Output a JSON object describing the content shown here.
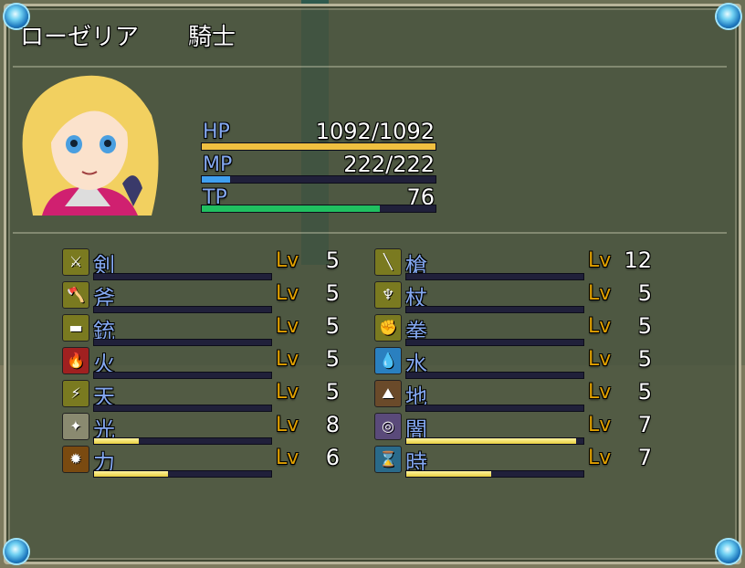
{
  "actor": {
    "name": "ローゼリア",
    "class": "騎士"
  },
  "stats": {
    "hp": {
      "label": "HP",
      "value": "1092/1092",
      "ratio": 1.0,
      "color": "#f0c040"
    },
    "mp": {
      "label": "MP",
      "value": "222/222",
      "ratio": 0.12,
      "color": "#40a0f0"
    },
    "tp": {
      "label": "TP",
      "value": "76",
      "ratio": 0.76,
      "color": "#20c060"
    }
  },
  "lv_label": "Lv",
  "skills_left": [
    {
      "name": "剣",
      "icon": "sword-icon",
      "glyph": "⚔",
      "icon_bg": "#7a7a20",
      "level": "5",
      "progress": 0.0
    },
    {
      "name": "斧",
      "icon": "axe-icon",
      "glyph": "🪓",
      "icon_bg": "#7a7a20",
      "level": "5",
      "progress": 0.0
    },
    {
      "name": "銃",
      "icon": "gun-icon",
      "glyph": "▬",
      "icon_bg": "#7a7a20",
      "level": "5",
      "progress": 0.0
    },
    {
      "name": "火",
      "icon": "fire-icon",
      "glyph": "🔥",
      "icon_bg": "#a02020",
      "level": "5",
      "progress": 0.0
    },
    {
      "name": "天",
      "icon": "lightning-icon",
      "glyph": "⚡",
      "icon_bg": "#7a7a20",
      "level": "5",
      "progress": 0.0
    },
    {
      "name": "光",
      "icon": "light-icon",
      "glyph": "✦",
      "icon_bg": "#8a8a70",
      "level": "8",
      "progress": 0.25
    },
    {
      "name": "力",
      "icon": "power-icon",
      "glyph": "✹",
      "icon_bg": "#7a4a10",
      "level": "6",
      "progress": 0.42
    }
  ],
  "skills_right": [
    {
      "name": "槍",
      "icon": "spear-icon",
      "glyph": "╲",
      "icon_bg": "#7a7a20",
      "level": "12",
      "progress": 0.0
    },
    {
      "name": "杖",
      "icon": "staff-icon",
      "glyph": "♆",
      "icon_bg": "#7a7a20",
      "level": "5",
      "progress": 0.0
    },
    {
      "name": "拳",
      "icon": "fist-icon",
      "glyph": "✊",
      "icon_bg": "#7a7a20",
      "level": "5",
      "progress": 0.0
    },
    {
      "name": "水",
      "icon": "water-icon",
      "glyph": "💧",
      "icon_bg": "#2a80c0",
      "level": "5",
      "progress": 0.0
    },
    {
      "name": "地",
      "icon": "earth-icon",
      "glyph": "⛰",
      "icon_bg": "#6a4a2a",
      "level": "5",
      "progress": 0.0
    },
    {
      "name": "闇",
      "icon": "darkness-icon",
      "glyph": "◎",
      "icon_bg": "#5a4a7a",
      "level": "7",
      "progress": 0.96
    },
    {
      "name": "時",
      "icon": "time-icon",
      "glyph": "⌛",
      "icon_bg": "#2a6a8a",
      "level": "7",
      "progress": 0.48
    }
  ]
}
